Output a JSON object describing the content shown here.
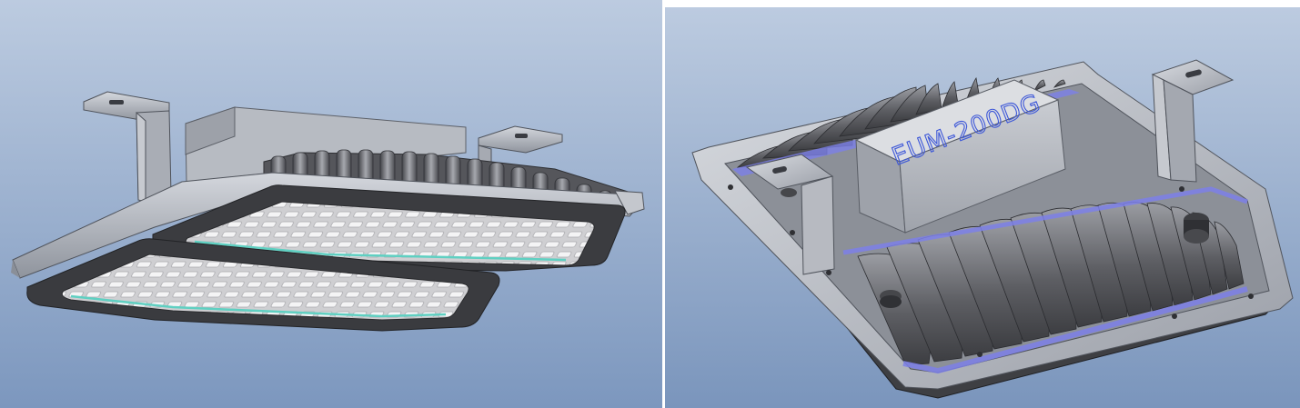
{
  "views": [
    {
      "name": "front-view",
      "description_visible": false
    },
    {
      "name": "rear-view",
      "ballast_label": "EUM-200DG"
    }
  ],
  "colors": {
    "viewport_top": "#b9c9de",
    "viewport_bottom": "#7f99bf",
    "metal": "#b8bcc4",
    "metal_dark": "#6b6f78",
    "housing": "#3c3c40",
    "led_panel": "#d9d9db",
    "glass_edge": "#5fd0c2",
    "gasket": "#7f86e6",
    "label_text": "#3d57d8"
  }
}
